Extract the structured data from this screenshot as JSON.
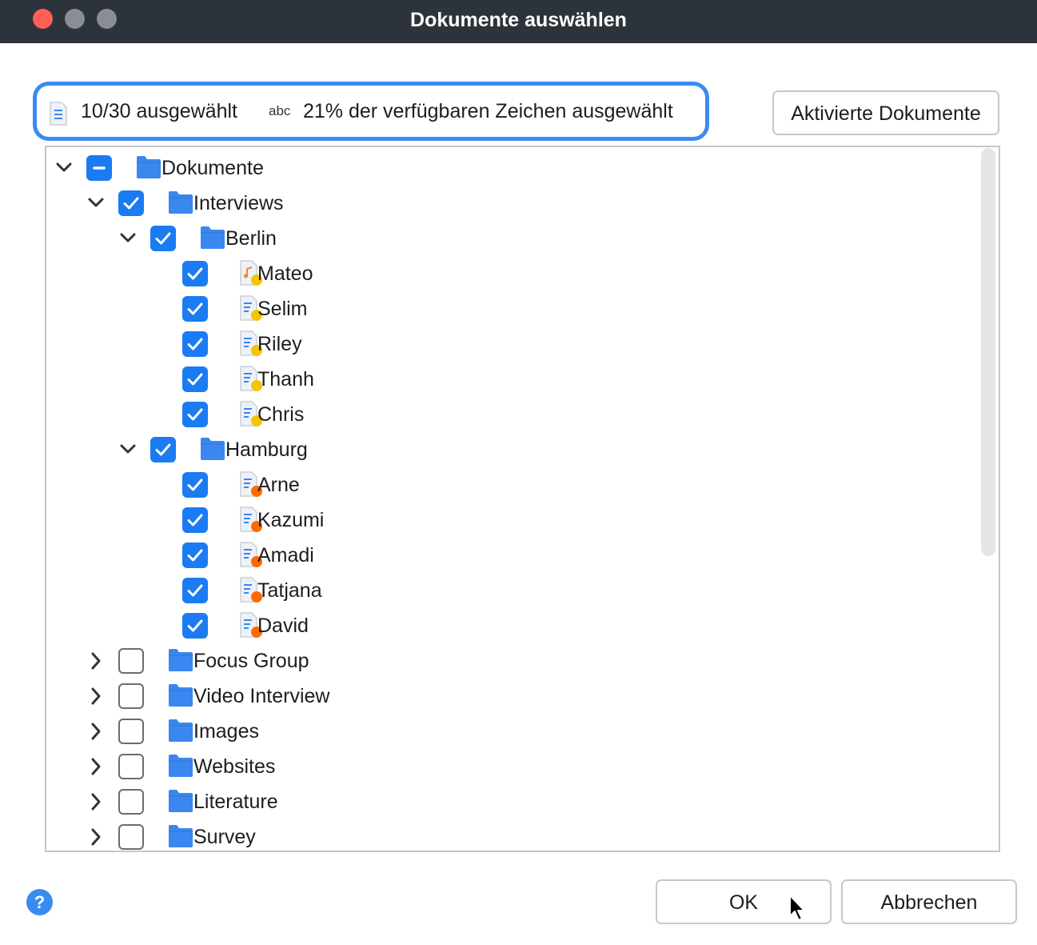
{
  "window": {
    "title": "Dokumente auswählen"
  },
  "info": {
    "count_text": "10/30 ausgewählt",
    "chars_label": "abc",
    "chars_text": "21% der verfügbaren Zeichen ausgewählt"
  },
  "buttons": {
    "activated": "Aktivierte Dokumente",
    "ok": "OK",
    "cancel": "Abbrechen",
    "help": "?"
  },
  "colors": {
    "accent": "#1a7bf2",
    "folder": "#3a87f0",
    "badge_yellow": "#f5c400",
    "badge_orange": "#ff6a00"
  },
  "tree": {
    "rows": [
      {
        "label": "Dokumente",
        "type": "folder",
        "state": "partial",
        "expander": "expanded",
        "level": 0
      },
      {
        "label": "Interviews",
        "type": "folder",
        "state": "checked",
        "expander": "expanded",
        "level": 1
      },
      {
        "label": "Berlin",
        "type": "folder",
        "state": "checked",
        "expander": "expanded",
        "level": 2
      },
      {
        "label": "Mateo",
        "type": "audio",
        "state": "checked",
        "expander": "none",
        "level": 3,
        "badge": "yellow"
      },
      {
        "label": "Selim",
        "type": "text",
        "state": "checked",
        "expander": "none",
        "level": 3,
        "badge": "yellow"
      },
      {
        "label": "Riley",
        "type": "text",
        "state": "checked",
        "expander": "none",
        "level": 3,
        "badge": "yellow"
      },
      {
        "label": "Thanh",
        "type": "text",
        "state": "checked",
        "expander": "none",
        "level": 3,
        "badge": "yellow"
      },
      {
        "label": "Chris",
        "type": "text",
        "state": "checked",
        "expander": "none",
        "level": 3,
        "badge": "yellow"
      },
      {
        "label": "Hamburg",
        "type": "folder",
        "state": "checked",
        "expander": "expanded",
        "level": 2
      },
      {
        "label": "Arne",
        "type": "text",
        "state": "checked",
        "expander": "none",
        "level": 3,
        "badge": "orange"
      },
      {
        "label": "Kazumi",
        "type": "text",
        "state": "checked",
        "expander": "none",
        "level": 3,
        "badge": "orange"
      },
      {
        "label": "Amadi",
        "type": "text",
        "state": "checked",
        "expander": "none",
        "level": 3,
        "badge": "orange"
      },
      {
        "label": "Tatjana",
        "type": "text",
        "state": "checked",
        "expander": "none",
        "level": 3,
        "badge": "orange"
      },
      {
        "label": "David",
        "type": "text",
        "state": "checked",
        "expander": "none",
        "level": 3,
        "badge": "orange"
      },
      {
        "label": "Focus Group",
        "type": "folder",
        "state": "unchecked",
        "expander": "collapsed",
        "level": 1
      },
      {
        "label": "Video Interview",
        "type": "folder",
        "state": "unchecked",
        "expander": "collapsed",
        "level": 1
      },
      {
        "label": "Images",
        "type": "folder",
        "state": "unchecked",
        "expander": "collapsed",
        "level": 1
      },
      {
        "label": "Websites",
        "type": "folder",
        "state": "unchecked",
        "expander": "collapsed",
        "level": 1
      },
      {
        "label": "Literature",
        "type": "folder",
        "state": "unchecked",
        "expander": "collapsed",
        "level": 1
      },
      {
        "label": "Survey",
        "type": "folder",
        "state": "unchecked",
        "expander": "collapsed",
        "level": 1
      }
    ]
  }
}
